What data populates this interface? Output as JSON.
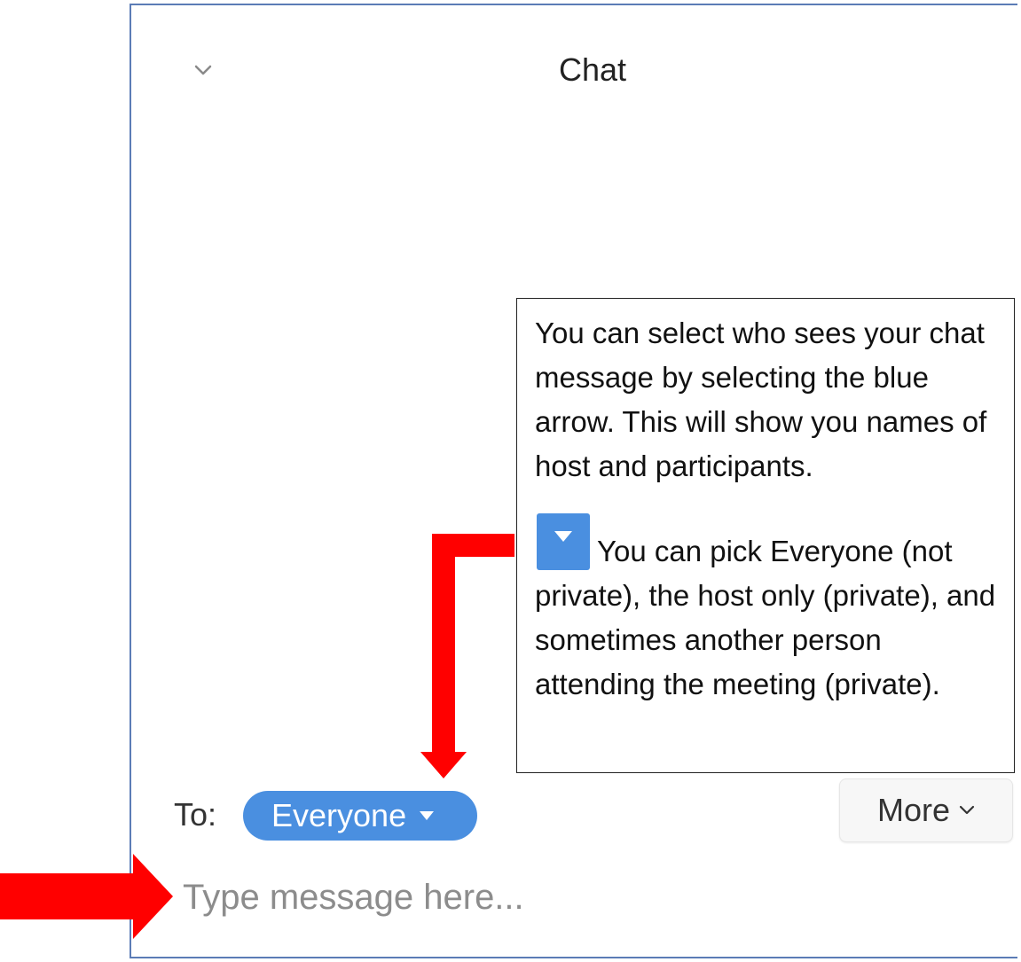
{
  "chat_panel": {
    "title": "Chat",
    "collapse_icon": "chevron-down-icon"
  },
  "callout": {
    "paragraph_1": "You can select who sees your chat message by selecting the blue arrow. This will show you names of host and participants.",
    "paragraph_2": "You can pick Everyone (not private), the host only (private), and sometimes another person attending the meeting (private).",
    "arrow_icon": "caret-down-icon"
  },
  "composer": {
    "to_label": "To:",
    "recipient": "Everyone",
    "more_label": "More",
    "input_value": "",
    "input_placeholder": "Type message here..."
  },
  "annotations": {
    "arrow_color": "#ff0000",
    "accent_color": "#4a8fe0",
    "border_color": "#5b7cb6"
  }
}
